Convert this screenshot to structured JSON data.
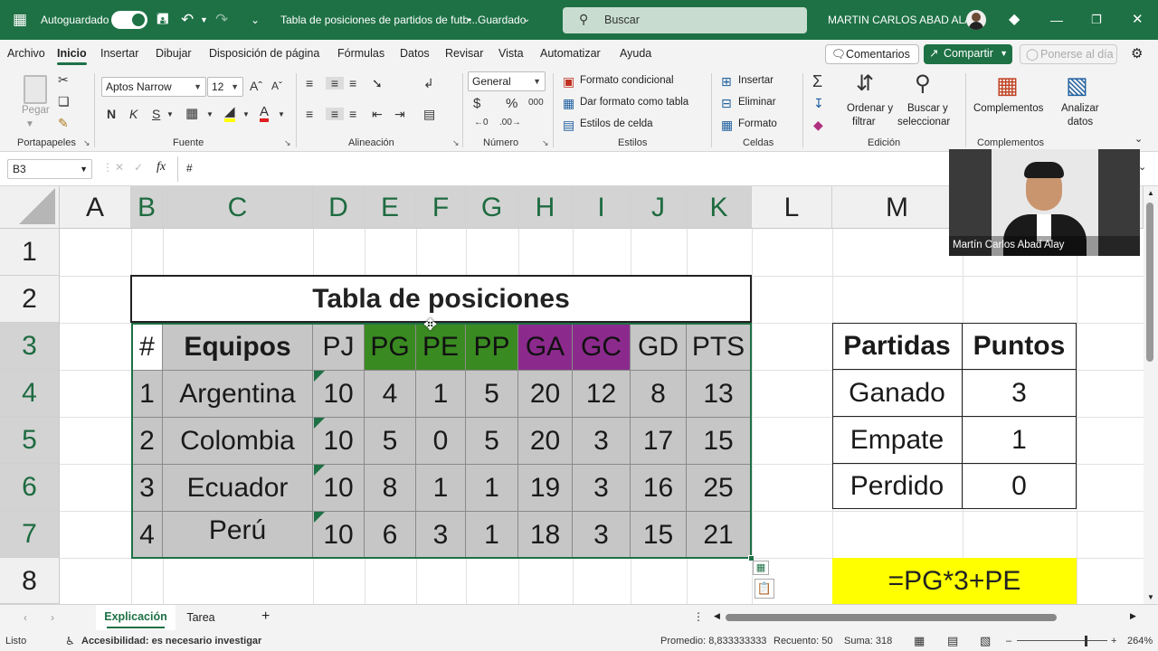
{
  "titlebar": {
    "autosave_label": "Autoguardado",
    "doc_title": "Tabla de posiciones de partidos de futb...",
    "saved_state": "Guardado",
    "search_placeholder": "Buscar",
    "user_name": "MARTIN CARLOS ABAD ALAY"
  },
  "menu": {
    "items": [
      "Archivo",
      "Inicio",
      "Insertar",
      "Dibujar",
      "Disposición de página",
      "Fórmulas",
      "Datos",
      "Revisar",
      "Vista",
      "Automatizar",
      "Ayuda"
    ],
    "comments": "Comentarios",
    "share": "Compartir",
    "catchup": "Ponerse al día"
  },
  "ribbon": {
    "paste": "Pegar",
    "font_name": "Aptos Narrow",
    "font_size": "12",
    "bold": "N",
    "italic": "K",
    "underline": "S",
    "number_format": "General",
    "conditional_format": "Formato condicional",
    "format_as_table": "Dar formato como tabla",
    "cell_styles": "Estilos de celda",
    "insert": "Insertar",
    "delete": "Eliminar",
    "format": "Formato",
    "sort_filter_1": "Ordenar y",
    "sort_filter_2": "filtrar",
    "find_select_1": "Buscar y",
    "find_select_2": "seleccionar",
    "addins": "Complementos",
    "analyze_1": "Analizar",
    "analyze_2": "datos",
    "groups": {
      "clipboard": "Portapapeles",
      "font": "Fuente",
      "alignment": "Alineación",
      "number": "Número",
      "styles": "Estilos",
      "cells": "Celdas",
      "editing": "Edición",
      "addins": "Complementos"
    }
  },
  "formula_bar": {
    "name_box": "B3",
    "fx": "fx",
    "content": "#"
  },
  "grid": {
    "columns": [
      "A",
      "B",
      "C",
      "D",
      "E",
      "F",
      "G",
      "H",
      "I",
      "J",
      "K",
      "L",
      "M"
    ],
    "rows": [
      "1",
      "2",
      "3",
      "4",
      "5",
      "6",
      "7",
      "8"
    ],
    "table_title": "Tabla de posiciones",
    "headers": [
      "#",
      "Equipos",
      "PJ",
      "PG",
      "PE",
      "PP",
      "GA",
      "GC",
      "GD",
      "PTS"
    ],
    "teams": [
      [
        "1",
        "Argentina",
        "10",
        "4",
        "1",
        "5",
        "20",
        "12",
        "8",
        "13"
      ],
      [
        "2",
        "Colombia",
        "10",
        "5",
        "0",
        "5",
        "20",
        "3",
        "17",
        "15"
      ],
      [
        "3",
        "Ecuador",
        "10",
        "8",
        "1",
        "1",
        "19",
        "3",
        "16",
        "25"
      ],
      [
        "4",
        "Perú",
        "10",
        "6",
        "3",
        "1",
        "18",
        "3",
        "15",
        "21"
      ]
    ],
    "points_headers": [
      "Partidas",
      "Puntos"
    ],
    "points": [
      [
        "Ganado",
        "3"
      ],
      [
        "Empate",
        "1"
      ],
      [
        "Perdido",
        "0"
      ]
    ],
    "formula_note": "=PG*3+PE"
  },
  "camera": {
    "caption": "Martín Carlos Abad Alay"
  },
  "sheets": {
    "tabs": [
      "Explicación",
      "Tarea"
    ],
    "active": "Explicación"
  },
  "status": {
    "ready": "Listo",
    "accessibility": "Accesibilidad: es necesario investigar",
    "average": "Promedio: 8,833333333",
    "count": "Recuento: 50",
    "sum": "Suma: 318",
    "zoom": "264%"
  },
  "colors": {
    "excel_green": "#1e7145",
    "header_gray": "#c6c6c6",
    "win_green": "#3a8a22",
    "goals_purple": "#8b2a8c",
    "formula_yellow": "#ffff00"
  }
}
